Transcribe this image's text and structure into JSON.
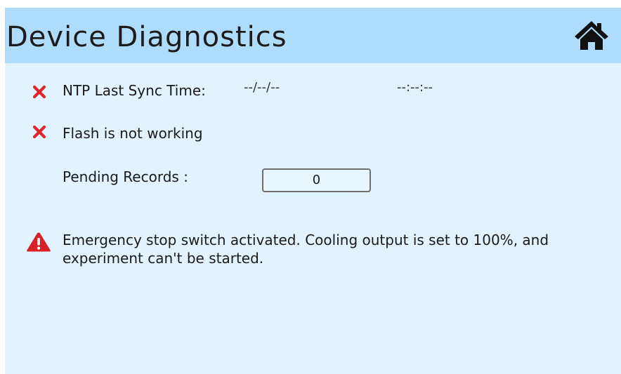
{
  "header": {
    "title": "Device Diagnostics",
    "home_icon": "home-icon"
  },
  "ntp": {
    "status_icon": "error-x-icon",
    "label": "NTP Last Sync Time:",
    "date": "--/--/--",
    "time": "--:--:--"
  },
  "flash": {
    "status_icon": "error-x-icon",
    "label": "Flash is not working"
  },
  "pending": {
    "label": "Pending Records :",
    "value": "0"
  },
  "warning": {
    "icon": "warning-triangle-icon",
    "message": "Emergency stop switch activated. Cooling output is set to 100%, and experiment can't be started."
  },
  "colors": {
    "header_bg": "#b0dcfb",
    "body_bg": "#e1f3fe",
    "error_red": "#e0262a",
    "warning_red": "#d92027"
  }
}
